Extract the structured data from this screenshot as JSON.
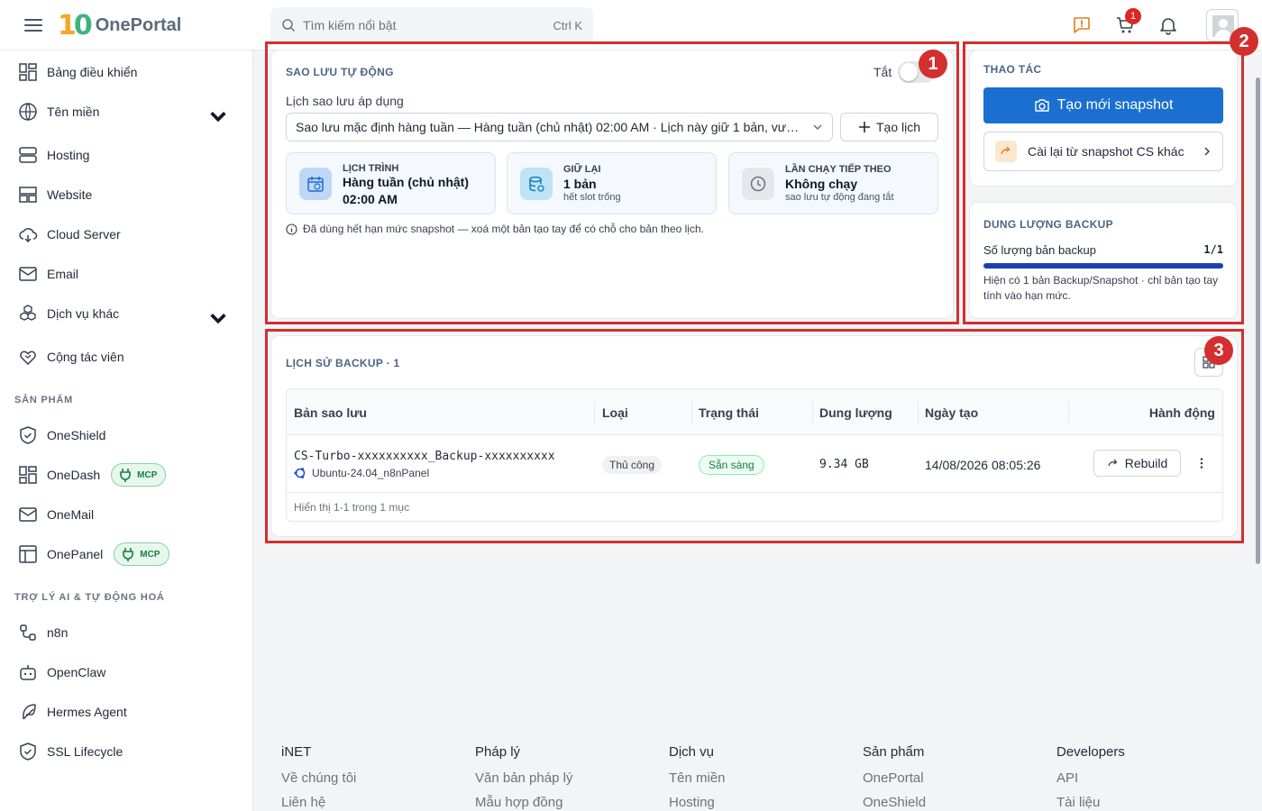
{
  "header": {
    "brand": "OnePortal",
    "logo_mark": "10",
    "search_placeholder": "Tìm kiếm nổi bật",
    "search_shortcut": "Ctrl K",
    "cart_count": "1"
  },
  "sidebar": {
    "items": [
      {
        "label": "Bảng điều khiển",
        "icon": "dashboard-icon"
      },
      {
        "label": "Tên miền",
        "icon": "globe-icon"
      },
      {
        "label": "Hosting",
        "icon": "server-icon"
      },
      {
        "label": "Website",
        "icon": "website-icon"
      },
      {
        "label": "Cloud Server",
        "icon": "cloud-icon"
      },
      {
        "label": "Email",
        "icon": "mail-icon"
      },
      {
        "label": "Dịch vụ khác",
        "icon": "boxes-icon"
      },
      {
        "label": "Cộng tác viên",
        "icon": "handshake-icon"
      }
    ],
    "section_products": "SẢN PHẨM",
    "products": [
      {
        "label": "OneShield",
        "icon": "shield-icon"
      },
      {
        "label": "OneDash",
        "icon": "dashboard-icon",
        "badge": "MCP"
      },
      {
        "label": "OneMail",
        "icon": "mail-icon"
      },
      {
        "label": "OnePanel",
        "icon": "panel-icon",
        "badge": "MCP"
      }
    ],
    "section_ai": "TRỢ LÝ AI & TỰ ĐỘNG HOÁ",
    "ai": [
      {
        "label": "n8n",
        "icon": "workflow-icon"
      },
      {
        "label": "OpenClaw",
        "icon": "robot-icon"
      },
      {
        "label": "Hermes Agent",
        "icon": "feather-icon"
      },
      {
        "label": "SSL Lifecycle",
        "icon": "shield-check-icon"
      }
    ]
  },
  "auto_backup": {
    "title": "SAO LƯU TỰ ĐỘNG",
    "toggle_label": "Tắt",
    "toggle_on": false,
    "schedule_label": "Lịch sao lưu áp dụng",
    "schedule_value": "Sao lưu mặc định hàng tuần — Hàng tuần (chủ nhật) 02:00 AM · Lịch này giữ 1 bản, vư…",
    "create_button": "Tạo lịch",
    "stats": [
      {
        "label": "LỊCH TRÌNH",
        "value": "Hàng tuần (chủ nhật)",
        "value2": "02:00 AM",
        "icon": "calendar-icon"
      },
      {
        "label": "GIỮ LẠI",
        "value": "1 bản",
        "sub": "hết slot trống",
        "icon": "database-icon"
      },
      {
        "label": "LẦN CHẠY TIẾP THEO",
        "value": "Không chạy",
        "sub": "sao lưu tự động đang tắt",
        "icon": "clock-icon"
      }
    ],
    "note": "Đã dùng hết hạn mức snapshot — xoá một bản tạo tay để có chỗ cho bản theo lịch."
  },
  "actions": {
    "title": "THAO TÁC",
    "create_snapshot": "Tạo mới snapshot",
    "restore_other": "Cài lại từ snapshot CS khác"
  },
  "quota": {
    "title": "DUNG LƯỢNG BACKUP",
    "label": "Số lượng bản backup",
    "value": "1/1",
    "fill_fraction": 1.0,
    "note": "Hiện có 1 bản Backup/Snapshot · chỉ bản tạo tay tính vào hạn mức."
  },
  "history": {
    "title": "LỊCH SỬ BACKUP · 1",
    "columns": [
      "Bản sao lưu",
      "Loại",
      "Trạng thái",
      "Dung lượng",
      "Ngày tạo",
      "Hành động"
    ],
    "rows": [
      {
        "name": "CS-Turbo-xxxxxxxxxx_Backup-xxxxxxxxxx",
        "os": "Ubuntu-24.04_n8nPanel",
        "type": "Thủ công",
        "status": "Sẵn sàng",
        "size": "9.34 GB",
        "created": "14/08/2026 08:05:26",
        "action": "Rebuild"
      }
    ],
    "footer": "Hiển thị 1-1 trong 1 mục"
  },
  "annotations": [
    "1",
    "2",
    "3"
  ],
  "footer": {
    "columns": [
      {
        "head": "iNET",
        "links": [
          "Về chúng tôi",
          "Liên hệ"
        ]
      },
      {
        "head": "Pháp lý",
        "links": [
          "Văn bản pháp lý",
          "Mẫu hợp đồng"
        ]
      },
      {
        "head": "Dịch vụ",
        "links": [
          "Tên miền",
          "Hosting"
        ]
      },
      {
        "head": "Sản phẩm",
        "links": [
          "OnePortal",
          "OneShield"
        ]
      },
      {
        "head": "Developers",
        "links": [
          "API",
          "Tài liệu"
        ]
      }
    ]
  },
  "colors": {
    "accent": "#1a6fd1",
    "annotation": "#d32f2f",
    "success": "#15803d"
  }
}
